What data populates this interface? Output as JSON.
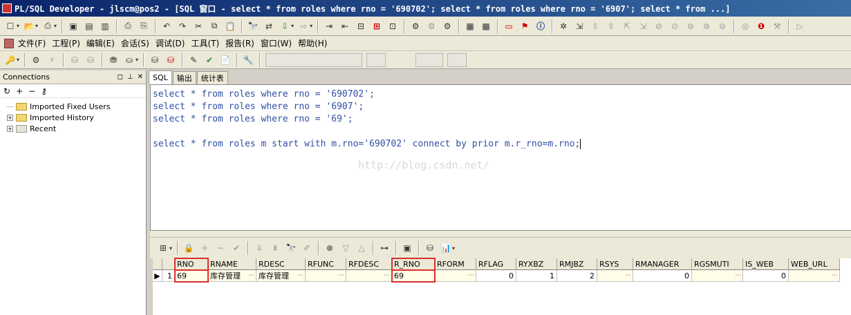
{
  "window": {
    "title": "PL/SQL Developer - jlscm@pos2 - [SQL 窗口 - select * from roles where rno = '690702'; select * from roles where rno = '6907'; select * from  ...]"
  },
  "menu": {
    "items": [
      "文件(F)",
      "工程(P)",
      "编辑(E)",
      "会话(S)",
      "调试(D)",
      "工具(T)",
      "报告(R)",
      "窗口(W)",
      "帮助(H)"
    ]
  },
  "connections": {
    "title": "Connections",
    "tree": [
      {
        "label": "Imported Fixed Users",
        "expandable": false
      },
      {
        "label": "Imported History",
        "expandable": true
      },
      {
        "label": "Recent",
        "expandable": true
      }
    ]
  },
  "tabs": [
    "SQL",
    "输出",
    "统计表"
  ],
  "editor": {
    "lines": [
      "select * from roles where rno = '690702';",
      "select * from roles where rno = '6907';",
      "select * from roles where rno = '69';",
      "",
      "select * from roles m start with m.rno='690702' connect by prior m.r_rno=m.rno;"
    ],
    "watermark": "http://blog.csdn.net/"
  },
  "result_grid": {
    "columns": [
      "RNO",
      "RNAME",
      "RDESC",
      "RFUNC",
      "RFDESC",
      "R_RNO",
      "RFORM",
      "RFLAG",
      "RYXBZ",
      "RMJBZ",
      "RSYS",
      "RMANAGER",
      "RGSMUTI",
      "IS_WEB",
      "WEB_URL"
    ],
    "rows": [
      {
        "num": "1",
        "RNO": "69",
        "RNAME": "库存管理",
        "RDESC": "库存管理",
        "RFUNC": "",
        "RFDESC": "",
        "R_RNO": "69",
        "RFORM": "",
        "RFLAG": "0",
        "RYXBZ": "1",
        "RMJBZ": "2",
        "RSYS": "",
        "RMANAGER": "0",
        "RGSMUTI": "",
        "IS_WEB": "0",
        "WEB_URL": ""
      }
    ],
    "highlight_color": "#d9302c"
  }
}
